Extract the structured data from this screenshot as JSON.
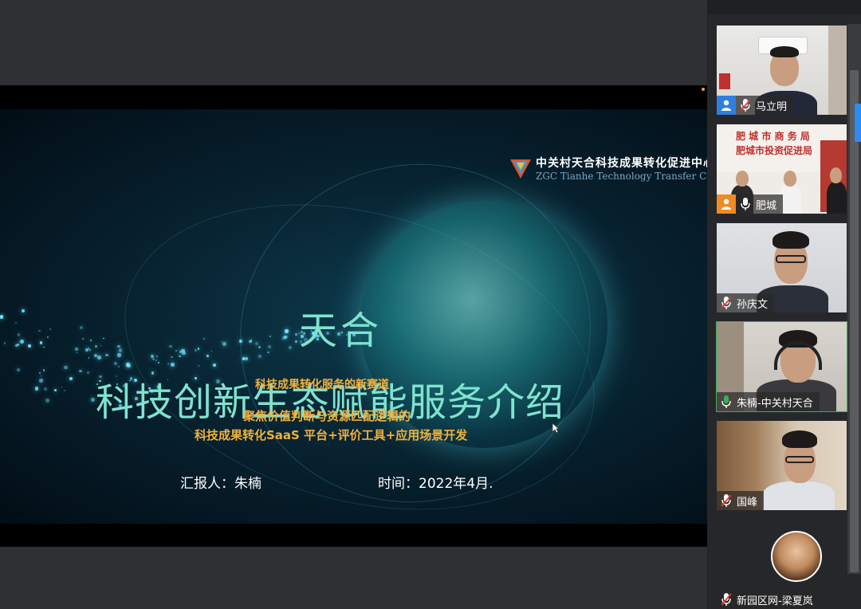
{
  "slide": {
    "logo_cn": "中关村天合科技成果转化促进中心",
    "logo_en": "ZGC Tianhe Technology Transfer Center",
    "title_line1": "天合",
    "title_line2": "科技创新生态赋能服务介绍",
    "subtitle1": "科技成果转化服务的新赛道",
    "subtitle2": "聚焦价值判断与资源匹配逻辑的",
    "subtitle3": "科技成果转化SaaS 平台+评价工具+应用场景开发",
    "reporter": "汇报人：朱楠",
    "date": "时间：2022年4月."
  },
  "participants": [
    {
      "name": "马立明",
      "avatar_color": "#2f7fe0",
      "mic": "muted",
      "speaking": false
    },
    {
      "name": "肥城",
      "avatar_color": "#f08a24",
      "mic": "on",
      "speaking": false,
      "banner_line1": "肥 城 市 商 务 局",
      "banner_line2": "肥城市投资促进局"
    },
    {
      "name": "孙庆文",
      "avatar_color": "",
      "mic": "muted",
      "speaking": false
    },
    {
      "name": "朱楠-中关村天合",
      "avatar_color": "",
      "mic": "active",
      "speaking": true
    },
    {
      "name": "国峰",
      "avatar_color": "",
      "mic": "muted",
      "speaking": false
    },
    {
      "name": "新园区网-梁夏岚",
      "avatar_color": "",
      "mic": "muted",
      "speaking": false
    }
  ],
  "colors": {
    "accent_active": "#3eae5d",
    "title_color": "#7fe3cf",
    "subtitle_color": "#f0b03c"
  }
}
